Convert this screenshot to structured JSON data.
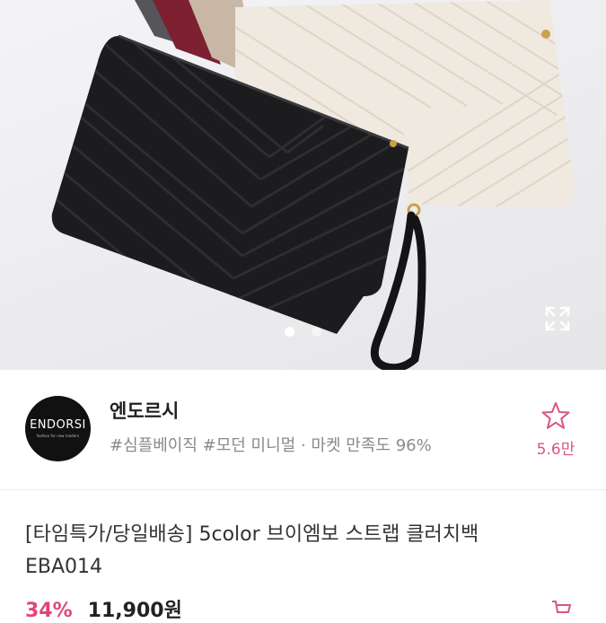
{
  "hero": {
    "image_alt": "",
    "pagination": {
      "current": 1,
      "total": 2
    },
    "expand_icon": "expand-icon"
  },
  "seller": {
    "logo_text": "ENDORSI",
    "logo_tagline": "fashion for new modern",
    "name": "엔도르시",
    "tags": [
      "#심플베이직",
      "#모던 미니멀"
    ],
    "separator": "·",
    "satisfaction_label": "마켓 만족도",
    "satisfaction_value": "96%",
    "favorite_count": "5.6만",
    "favorite_icon": "star-icon"
  },
  "product": {
    "title_line1": "[타임특가/당일배송] 5color 브이엠보 스트랩 클러치백",
    "title_line2": "EBA014",
    "discount": "34%",
    "price": "11,900원"
  },
  "colors": {
    "accent": "#e0467a",
    "text": "#222222",
    "muted": "#8a8a8a"
  }
}
